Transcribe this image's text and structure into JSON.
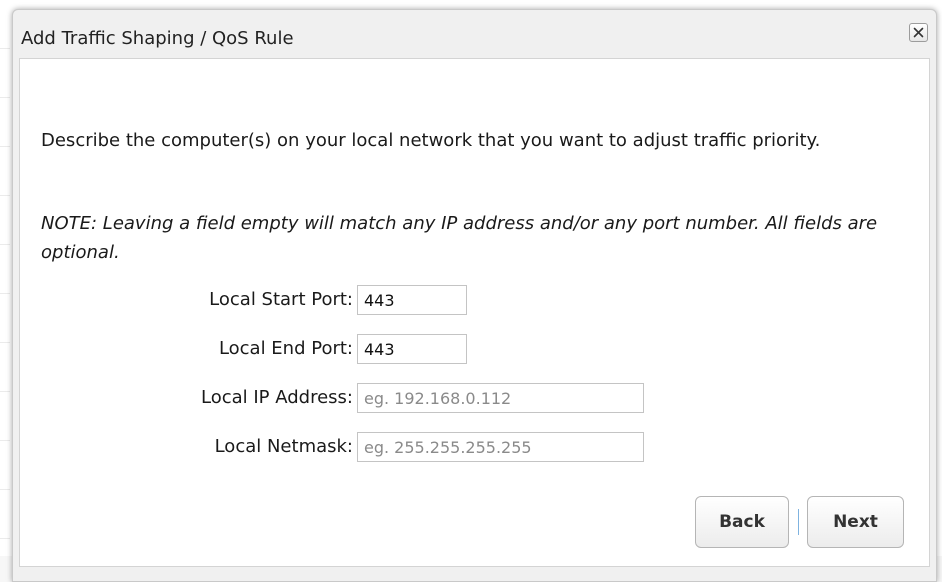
{
  "dialog": {
    "title": "Add Traffic Shaping / QoS Rule",
    "description": "Describe the computer(s) on your local network that you want to adjust traffic priority.",
    "note": "NOTE: Leaving a field empty will match any IP address and/or any port number. All fields are optional."
  },
  "form": {
    "local_start_port": {
      "label": "Local Start Port:",
      "value": "443",
      "placeholder": ""
    },
    "local_end_port": {
      "label": "Local End Port:",
      "value": "443",
      "placeholder": ""
    },
    "local_ip_address": {
      "label": "Local IP Address:",
      "value": "",
      "placeholder": "eg. 192.168.0.112"
    },
    "local_netmask": {
      "label": "Local Netmask:",
      "value": "",
      "placeholder": "eg. 255.255.255.255"
    }
  },
  "buttons": {
    "back_label": "Back",
    "next_label": "Next"
  },
  "icons": {
    "close": "close-icon"
  },
  "colors": {
    "dialog_background": "#f0f0f0",
    "content_background": "#ffffff",
    "button_separator": "#7fb3e0"
  }
}
